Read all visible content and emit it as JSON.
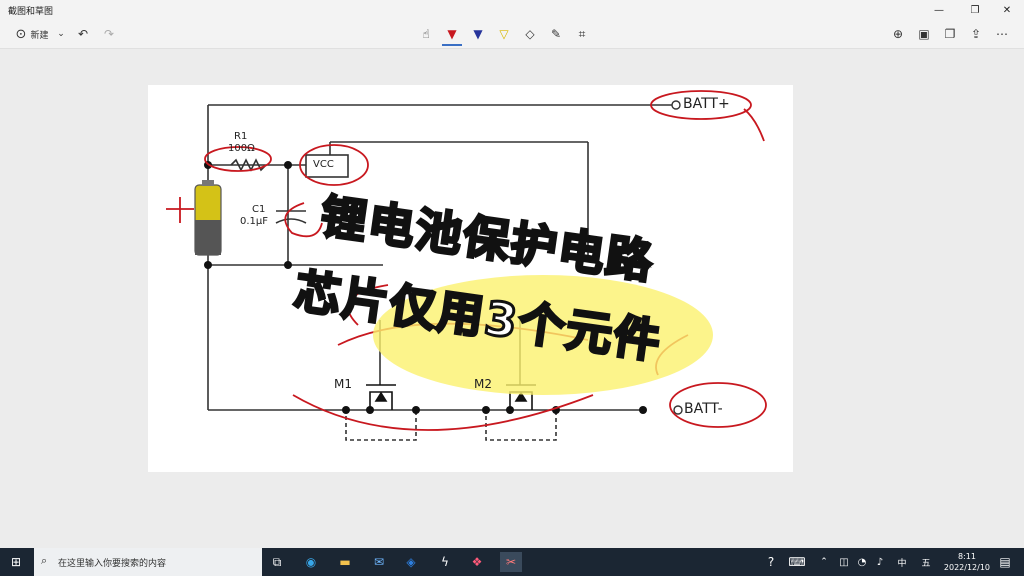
{
  "window": {
    "title": "截图和草图"
  },
  "toolbar": {
    "new_label": "新建"
  },
  "diagram": {
    "r1_label": "R1",
    "r1_value": "100Ω",
    "c1_label": "C1",
    "c1_value": "0.1μF",
    "vcc_label": "VCC",
    "batt_plus": "BATT+",
    "batt_minus": "BATT-",
    "m1_label": "M1",
    "m2_label": "M2"
  },
  "overlay": {
    "line1": "锂电池保护电路",
    "line2": "芯片仅用3个元件"
  },
  "taskbar": {
    "search_placeholder": "在这里输入你要搜索的内容",
    "time": "8:11",
    "date": "2022/12/10"
  },
  "colors": {
    "ink": "#c8181f",
    "highlight": "#fbf16e",
    "battery": "#d4c217"
  }
}
